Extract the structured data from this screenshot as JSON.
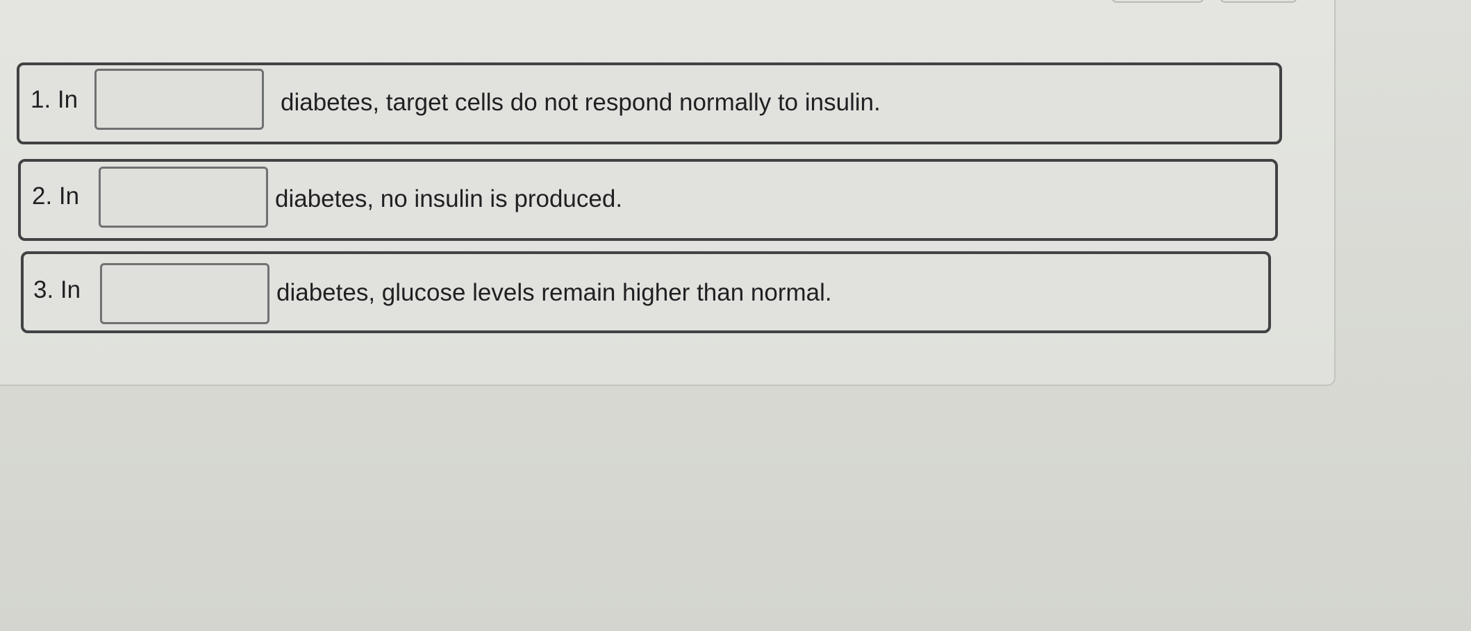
{
  "questions": [
    {
      "number": "1. In",
      "text": "diabetes, target cells do not respond normally to insulin.",
      "answer": ""
    },
    {
      "number": "2. In",
      "text": "diabetes, no insulin is produced.",
      "answer": ""
    },
    {
      "number": "3. In",
      "text": "diabetes, glucose levels remain higher than normal.",
      "answer": ""
    }
  ],
  "colors": {
    "row_border": "#404244",
    "blank_border": "#6f7172",
    "text": "#1f2022",
    "background": "#dedfda"
  }
}
